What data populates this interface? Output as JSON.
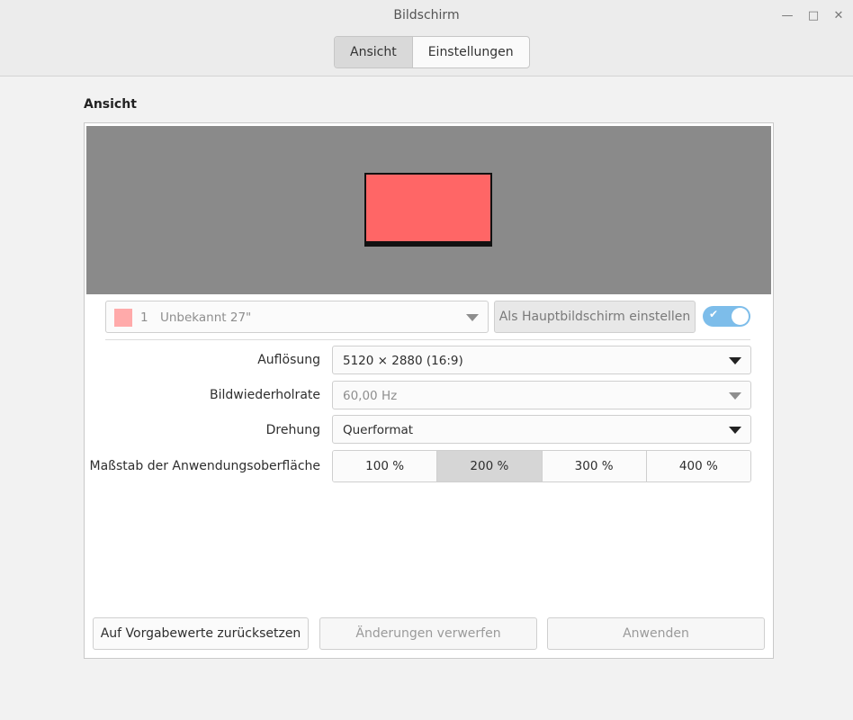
{
  "window": {
    "title": "Bildschirm"
  },
  "tabs": [
    {
      "label": "Ansicht",
      "active": true
    },
    {
      "label": "Einstellungen",
      "active": false
    }
  ],
  "section": {
    "title": "Ansicht"
  },
  "monitor": {
    "number": "1",
    "name": "Unbekannt 27\"",
    "set_primary_label": "Als Hauptbildschirm einstellen",
    "enabled": true,
    "color": "#ff6666"
  },
  "settings": {
    "resolution_label": "Auflösung",
    "resolution_value": "5120 × 2880 (16:9)",
    "refresh_label": "Bildwiederholrate",
    "refresh_value": "60,00 Hz",
    "rotation_label": "Drehung",
    "rotation_value": "Querformat",
    "scale_label": "Maßstab der Anwendungsoberfläche",
    "scale_options": [
      "100 %",
      "200 %",
      "300 %",
      "400 %"
    ],
    "scale_selected": "200 %"
  },
  "footer": {
    "reset_label": "Auf Vorgabewerte zurücksetzen",
    "discard_label": "Änderungen verwerfen",
    "apply_label": "Anwenden"
  }
}
